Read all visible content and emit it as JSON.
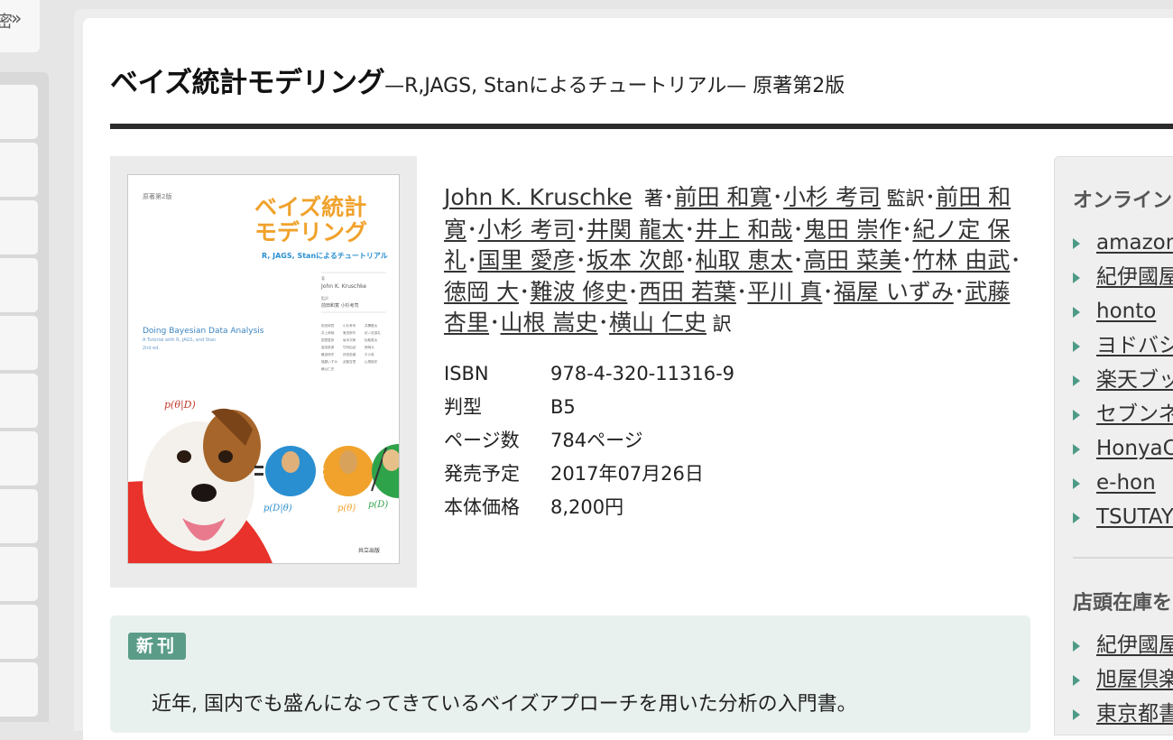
{
  "left_sidebar": {
    "top_fragment": "密",
    "expand_chevron": "»",
    "item_count": 11
  },
  "book": {
    "title_main": "ベイズ統計モデリング",
    "title_sub": "—R,JAGS, Stanによるチュートリアル— 原著第2版",
    "cover": {
      "edition": "原著第2版",
      "title_line1": "ベイズ統計",
      "title_line2": "モデリング",
      "subtitle": "R, JAGS, Stanによるチュートリアル",
      "author_label": "著",
      "author": "John K. Kruschke",
      "supervisor_label": "監訳",
      "supervisors": "前田和寛 小杉考司",
      "english_title": "Doing Bayesian Data Analysis",
      "english_sub": "A Tutorial with R, JAGS, and Stan",
      "english_ed": "2nd ed.",
      "translators": [
        "前田和寛",
        "小杉考司",
        "井関龍太",
        "井上和哉",
        "鬼田崇作",
        "紀ノ定保礼",
        "国里愛彦",
        "坂本次郎",
        "杣取恵太",
        "高田菜美",
        "竹林由武",
        "徳岡大",
        "難波修史",
        "西田若葉",
        "平川真",
        "福屋いずみ",
        "武藤杏里",
        "山根嵩史",
        "横山仁史"
      ],
      "formula_post": "p(θ|D)",
      "formula_like": "p(D|θ)",
      "formula_prior": "p(θ)",
      "formula_evid": "p(D)",
      "publisher": "共立出版"
    },
    "author_primary": "John K. Kruschke",
    "author_primary_role": "著",
    "supervisors": [
      "前田 和寛",
      "小杉 考司"
    ],
    "supervisors_role": "監訳",
    "translators": [
      "前田 和寛",
      "小杉 考司",
      "井関 龍太",
      "井上 和哉",
      "鬼田 崇作",
      "紀ノ定 保礼",
      "国里 愛彦",
      "坂本 次郎",
      "杣取 恵太",
      "高田 菜美",
      "竹林 由武",
      "徳岡 大",
      "難波 修史",
      "西田 若葉",
      "平川 真",
      "福屋 いずみ",
      "武藤 杏里",
      "山根 嵩史",
      "横山 仁史"
    ],
    "translators_role": "訳",
    "separator": "･",
    "meta": [
      {
        "label": "ISBN",
        "value": "978-4-320-11316-9"
      },
      {
        "label": "判型",
        "value": "B5"
      },
      {
        "label": "ページ数",
        "value": "784ページ"
      },
      {
        "label": "発売予定",
        "value": "2017年07月26日"
      },
      {
        "label": "本体価格",
        "value": "8,200円"
      }
    ],
    "new_badge": "新刊",
    "description": "近年, 国内でも盛んになってきているベイズアプローチを用いた分析の入門書。"
  },
  "right_sidebar": {
    "online_heading": "オンライン",
    "online_stores": [
      "amazon",
      "紀伊國屋",
      "honto",
      "ヨドバシ",
      "楽天ブッ",
      "セブンネ",
      "HonyaC",
      "e-hon",
      "TSUTAY"
    ],
    "instore_heading": "店頭在庫を",
    "instore_stores": [
      "紀伊國屋",
      "旭屋倶楽",
      "東京都書"
    ],
    "accent_color": "#4d9a86"
  }
}
